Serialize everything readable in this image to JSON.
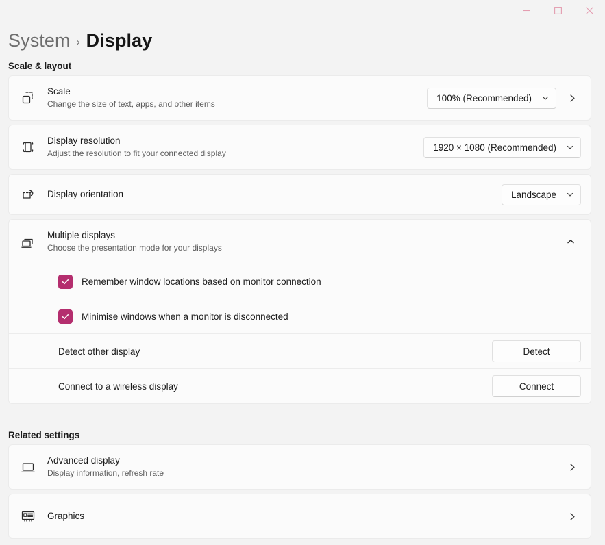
{
  "window": {
    "controls": [
      {
        "name": "minimize",
        "glyph": "minimize-icon"
      },
      {
        "name": "maximize",
        "glyph": "maximize-icon"
      },
      {
        "name": "close",
        "glyph": "close-icon"
      }
    ],
    "accent_pink": "#e49db0"
  },
  "header": {
    "parent": "System",
    "separator": "›",
    "current": "Display"
  },
  "sections": {
    "scale_layout": {
      "label": "Scale & layout"
    },
    "related": {
      "label": "Related settings"
    }
  },
  "scale_row": {
    "icon": "scale-icon",
    "title": "Scale",
    "subtitle": "Change the size of text, apps, and other items",
    "value": "100% (Recommended)"
  },
  "resolution_row": {
    "icon": "display-resolution-icon",
    "title": "Display resolution",
    "subtitle": "Adjust the resolution to fit your connected display",
    "value": "1920 × 1080 (Recommended)"
  },
  "orientation_row": {
    "icon": "display-orientation-icon",
    "title": "Display orientation",
    "value": "Landscape"
  },
  "multiple_displays": {
    "icon": "multiple-displays-icon",
    "title": "Multiple displays",
    "subtitle": "Choose the presentation mode for your displays",
    "expanded": true,
    "checkboxes": [
      {
        "label": "Remember window locations based on monitor connection",
        "checked": true
      },
      {
        "label": "Minimise windows when a monitor is disconnected",
        "checked": true
      }
    ],
    "actions": [
      {
        "label": "Detect other display",
        "button": "Detect"
      },
      {
        "label": "Connect to a wireless display",
        "button": "Connect"
      }
    ],
    "checkbox_color": "#b42e6e"
  },
  "related_settings": [
    {
      "icon": "advanced-display-icon",
      "title": "Advanced display",
      "subtitle": "Display information, refresh rate"
    },
    {
      "icon": "graphics-icon",
      "title": "Graphics",
      "subtitle": ""
    }
  ]
}
